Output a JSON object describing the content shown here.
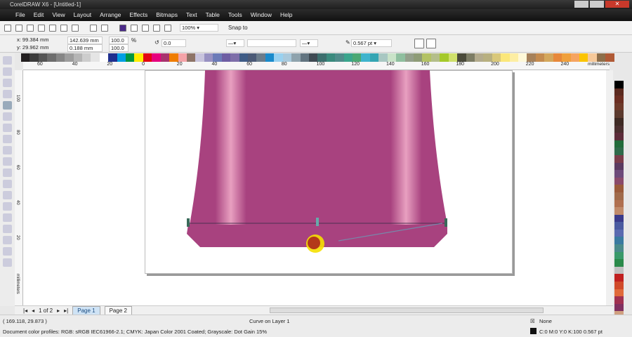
{
  "window": {
    "title": "CorelDRAW X6 - [Untitled-1]"
  },
  "menu": [
    "File",
    "Edit",
    "View",
    "Layout",
    "Arrange",
    "Effects",
    "Bitmaps",
    "Text",
    "Table",
    "Tools",
    "Window",
    "Help"
  ],
  "toolbar": {
    "zoom": "100%",
    "snap": "Snap to"
  },
  "props": {
    "x": "x: 99.384 mm",
    "y": "y: 29.962 mm",
    "w": "142.639 mm",
    "h": "0.188 mm",
    "sx": "100.0",
    "sy": "100.0",
    "pct": "%",
    "angle": "0.0",
    "outline": "0.567 pt"
  },
  "ruler": {
    "h_ticks": [
      "60",
      "40",
      "20",
      "0",
      "20",
      "40",
      "60",
      "80",
      "100",
      "120",
      "140",
      "160",
      "180",
      "200",
      "220",
      "240"
    ],
    "unit": "millimeters",
    "v_ticks": [
      "100",
      "80",
      "60",
      "40",
      "20"
    ],
    "v_unit": "millimeters"
  },
  "palette": [
    "#231f20",
    "#3c3c3c",
    "#555",
    "#6d6d6d",
    "#858585",
    "#9d9d9d",
    "#b5b5b5",
    "#cdcdcd",
    "#e5e5e5",
    "#fff",
    "#1f2f8f",
    "#009fe3",
    "#009640",
    "#ffed00",
    "#e30613",
    "#e6007e",
    "#a8336e",
    "#ef7d00",
    "#f4a3a8",
    "#8e7467",
    "#c8c4dd",
    "#9891c2",
    "#6c7bb8",
    "#6e5ea3",
    "#7e6ea9",
    "#3f5c86",
    "#4b5a77",
    "#6b7c8b",
    "#1a8acb",
    "#99d1f0",
    "#a9c9dc",
    "#8fa3ad",
    "#627480",
    "#3f4a53",
    "#3c6e6d",
    "#3a8a7d",
    "#4f8c8a",
    "#3aa58c",
    "#4ba873",
    "#3fb4cd",
    "#35a5b3",
    "#a8c7c2",
    "#c9e3c8",
    "#8fbf9f",
    "#94a08c",
    "#8e9c77",
    "#b3c264",
    "#b4be8a",
    "#a5c92a",
    "#cfe06a",
    "#4a4a3a",
    "#7d7d65",
    "#b3ab8d",
    "#b8b080",
    "#d9c87a",
    "#fbe77a",
    "#fdeea3",
    "#fef8d8",
    "#a6815a",
    "#c48b4f",
    "#d4a75c",
    "#e7883a",
    "#f0a03c",
    "#f6a460",
    "#fbc400",
    "#f6c99a",
    "#8d6e4a",
    "#b05a36"
  ],
  "right_palette": [
    "#000",
    "#5b2a1f",
    "#6b2e22",
    "#6d3a2a",
    "#5b3a2e",
    "#3e2a24",
    "#4a2f2f",
    "#5c2c3a",
    "#226b3a",
    "#2f6a4a",
    "#7a3c4a",
    "#5a3a60",
    "#6d4a7a",
    "#8a4a6a",
    "#9a5a3a",
    "#a06a4a",
    "#b07050",
    "#c08a6a",
    "#3a3a8a",
    "#4a5aa0",
    "#5a6ab0",
    "#3a7aa0",
    "#4a8a8a",
    "#3a9a6a",
    "#2a8a4a",
    "#c0c0c0",
    "#c02020",
    "#d04a2a",
    "#e06a3a",
    "#a03050",
    "#803060",
    "#d0a080"
  ],
  "pages": {
    "counter": "1 of 2",
    "tabs": [
      "Page 1",
      "Page 2"
    ]
  },
  "status": {
    "coords": "( 169.118, 29.873 )",
    "object": "Curve on Layer 1",
    "profiles": "Document color profiles: RGB: sRGB IEC61966-2.1; CMYK: Japan Color 2001 Coated; Grayscale: Dot Gain 15%",
    "fill": "None",
    "outline": "C:0 M:0 Y:0 K:100  0.567 pt"
  },
  "colors": {
    "shape": "#a8427f",
    "highlight": "#e8a0c0"
  }
}
